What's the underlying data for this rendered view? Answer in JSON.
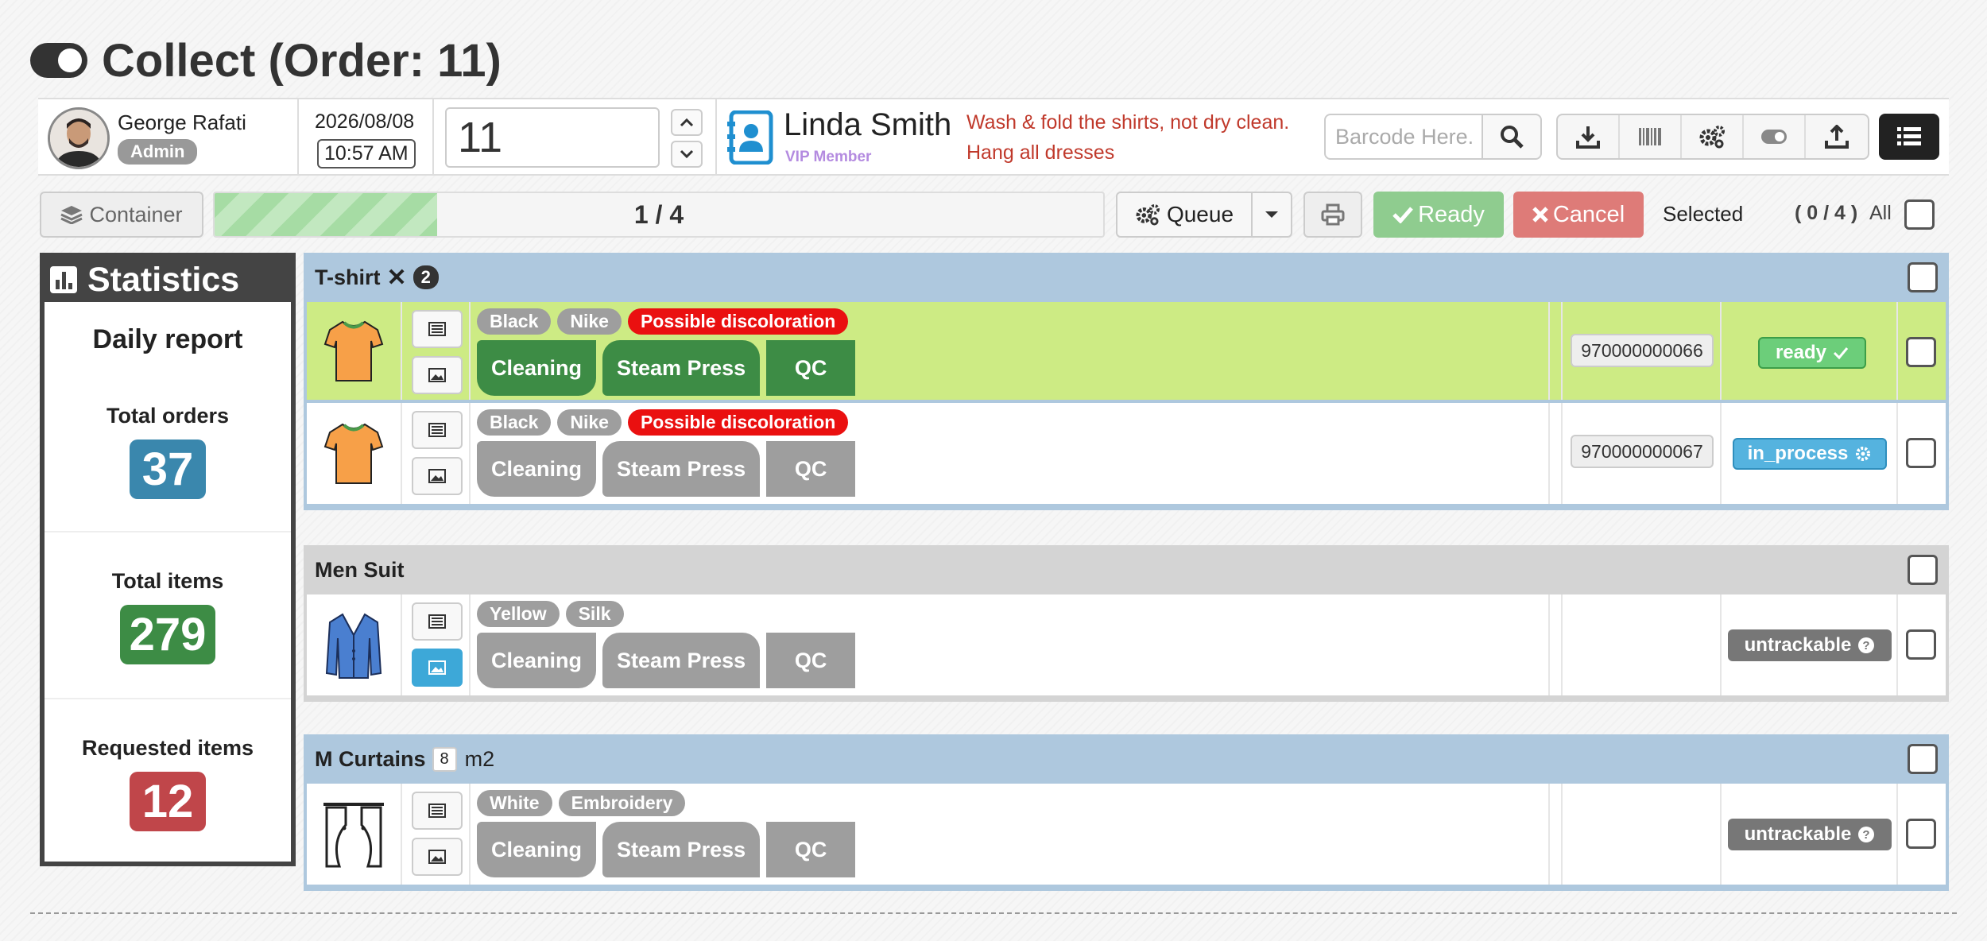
{
  "page": {
    "title": "Collect (Order: 11)"
  },
  "user": {
    "name": "George Rafati",
    "role": "Admin"
  },
  "datetime": {
    "date": "2026/08/08",
    "time": "10:57 AM"
  },
  "order": {
    "number": "11"
  },
  "customer": {
    "name": "Linda Smith",
    "membership": "VIP Member",
    "notes": [
      "Wash & fold the shirts, not dry clean.",
      "Hang all dresses"
    ]
  },
  "barcode": {
    "placeholder": "Barcode Here."
  },
  "toolbar": {
    "container_label": "Container",
    "progress_text": "1 / 4",
    "progress_value": 0.25,
    "queue_label": "Queue",
    "ready_label": "Ready",
    "cancel_label": "Cancel",
    "selected_label": "Selected",
    "selected_count": "( 0 / 4 )",
    "all_label": "All"
  },
  "stats": {
    "title": "Statistics",
    "subtitle": "Daily report",
    "items": [
      {
        "label": "Total orders",
        "value": "37",
        "color": "#3a87ad"
      },
      {
        "label": "Total items",
        "value": "279",
        "color": "#3d8c45"
      },
      {
        "label": "Requested items",
        "value": "12",
        "color": "#c0464a"
      }
    ]
  },
  "colors": {
    "accent_blue": "#aec8de",
    "ready_green": "#cdeb84",
    "process_dark": "#3d8c45",
    "tag_red": "#ea1010"
  },
  "groups": [
    {
      "name": "T-shirt",
      "count": "2",
      "items": [
        {
          "tags": [
            "Black",
            "Nike",
            "Possible discoloration"
          ],
          "processes": [
            "Cleaning",
            "Steam Press",
            "QC"
          ],
          "code": "970000000066",
          "status": "ready",
          "icon": "tshirt-icon"
        },
        {
          "tags": [
            "Black",
            "Nike",
            "Possible discoloration"
          ],
          "processes": [
            "Cleaning",
            "Steam Press",
            "QC"
          ],
          "code": "970000000067",
          "status": "in_process",
          "icon": "tshirt-icon"
        }
      ]
    },
    {
      "name": "Men Suit",
      "items": [
        {
          "tags": [
            "Yellow",
            "Silk"
          ],
          "processes": [
            "Cleaning",
            "Steam Press",
            "QC"
          ],
          "status": "untrackable",
          "icon": "suit-icon"
        }
      ]
    },
    {
      "name": "M Curtains",
      "quantity": "8",
      "unit": "m2",
      "items": [
        {
          "tags": [
            "White",
            "Embroidery"
          ],
          "processes": [
            "Cleaning",
            "Steam Press",
            "QC"
          ],
          "status": "untrackable",
          "icon": "curtain-icon"
        }
      ]
    }
  ]
}
